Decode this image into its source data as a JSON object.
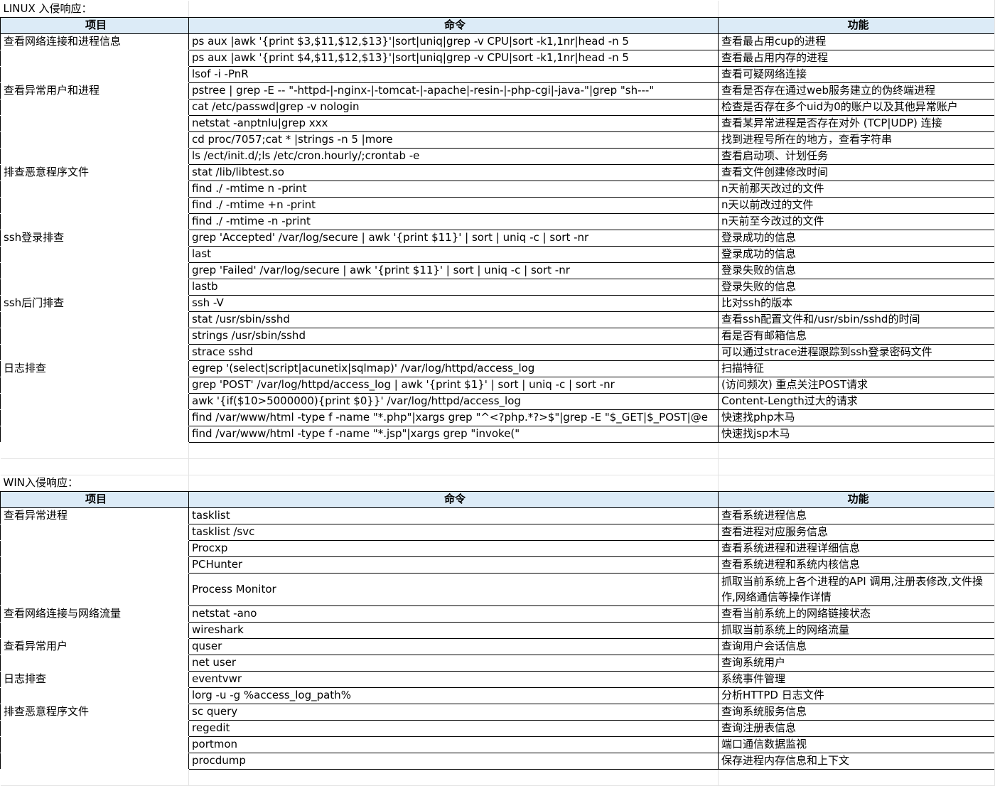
{
  "linux": {
    "title": "LINUX 入侵响应：",
    "headers": {
      "item": "项目",
      "cmd": "命令",
      "func": "功能"
    },
    "rows": [
      {
        "item": "查看网络连接和进程信息",
        "cmd": "ps aux |awk '{print $3,$11,$12,$13}'|sort|uniq|grep -v CPU|sort -k1,1nr|head -n 5",
        "func": "查看最占用cup的进程"
      },
      {
        "item": "",
        "cmd": "ps aux |awk '{print $4,$11,$12,$13}'|sort|uniq|grep -v CPU|sort -k1,1nr|head -n 5",
        "func": "查看最占用内存的进程"
      },
      {
        "item": "",
        "cmd": "lsof -i -PnR",
        "func": "查看可疑网络连接"
      },
      {
        "item": "查看异常用户和进程",
        "cmd": "pstree | grep -E -- \"-httpd-|-nginx-|-tomcat-|-apache|-resin-|-php-cgi|-java-\"|grep \"sh---\"",
        "func": "查看是否存在通过web服务建立的伪终端进程"
      },
      {
        "item": "",
        "cmd": "cat /etc/passwd|grep -v nologin",
        "func": "检查是否存在多个uid为0的账户以及其他异常账户"
      },
      {
        "item": "",
        "cmd": "netstat -anptnlu|grep xxx",
        "func": "查看某异常进程是否存在对外 (TCP|UDP) 连接"
      },
      {
        "item": "",
        "cmd": "cd proc/7057;cat * |strings -n 5 |more",
        "func": "找到进程号所在的地方，查看字符串"
      },
      {
        "item": "",
        "cmd": "ls /ect/init.d/;ls /etc/cron.hourly/;crontab -e",
        "func": "查看启动项、计划任务"
      },
      {
        "item": "排查恶意程序文件",
        "cmd": "stat /lib/libtest.so",
        "func": "查看文件创建修改时间"
      },
      {
        "item": "",
        "cmd": "find ./ -mtime n -print",
        "func": "n天前那天改过的文件"
      },
      {
        "item": "",
        "cmd": "find ./ -mtime +n -print",
        "func": "n天以前改过的文件"
      },
      {
        "item": "",
        "cmd": "find ./ -mtime -n -print",
        "func": "n天前至今改过的文件"
      },
      {
        "item": "ssh登录排查",
        "cmd": "grep 'Accepted' /var/log/secure | awk '{print $11}' | sort | uniq -c | sort -nr",
        "func": "登录成功的信息"
      },
      {
        "item": "",
        "cmd": "last",
        "func": "登录成功的信息"
      },
      {
        "item": "",
        "cmd": "grep 'Failed' /var/log/secure | awk '{print $11}' | sort | uniq -c | sort -nr",
        "func": "登录失败的信息"
      },
      {
        "item": "",
        "cmd": "lastb",
        "func": "登录失败的信息"
      },
      {
        "item": "ssh后门排查",
        "cmd": "ssh -V",
        "func": "比对ssh的版本"
      },
      {
        "item": "",
        "cmd": "stat /usr/sbin/sshd",
        "func": "查看ssh配置文件和/usr/sbin/sshd的时间"
      },
      {
        "item": "",
        "cmd": "strings /usr/sbin/sshd",
        "func": "看是否有邮箱信息"
      },
      {
        "item": "",
        "cmd": "strace sshd",
        "func": "可以通过strace进程跟踪到ssh登录密码文件"
      },
      {
        "item": "日志排查",
        "cmd": "egrep '(select|script|acunetix|sqlmap)' /var/log/httpd/access_log",
        "func": "扫描特征"
      },
      {
        "item": "",
        "cmd": "grep 'POST' /var/log/httpd/access_log | awk '{print $1}' | sort | uniq -c | sort -nr",
        "func": "(访问频次) 重点关注POST请求"
      },
      {
        "item": "",
        "cmd": "awk '{if($10>5000000){print $0}}' /var/log/httpd/access_log",
        "func": "Content-Length过大的请求"
      },
      {
        "item": "",
        "cmd": "find /var/www/html -type f -name \"*.php\"|xargs grep \"^<?php.*?>$\"|grep -E \"$_GET|$_POST|@e",
        "func": "快速找php木马"
      },
      {
        "item": "",
        "cmd": "find /var/www/html -type f -name \"*.jsp\"|xargs grep \"invoke(\"",
        "func": "快速找jsp木马"
      }
    ]
  },
  "win": {
    "title": "WIN入侵响应：",
    "headers": {
      "item": "项目",
      "cmd": "命令",
      "func": "功能"
    },
    "rows": [
      {
        "item": "查看异常进程",
        "cmd": "tasklist",
        "func": "查看系统进程信息"
      },
      {
        "item": "",
        "cmd": "tasklist /svc",
        "func": "查看进程对应服务信息"
      },
      {
        "item": "",
        "cmd": "Procxp",
        "func": "查看系统进程和进程详细信息"
      },
      {
        "item": "",
        "cmd": "PCHunter",
        "func": "查看系统进程和系统内核信息"
      },
      {
        "item": "",
        "cmd": "Process Monitor",
        "func": "抓取当前系统上各个进程的API 调用,注册表修改,文件操作,网络通信等操作详情",
        "tall": true
      },
      {
        "item": "查看网络连接与网络流量",
        "cmd": "netstat -ano",
        "func": "查看当前系统上的网络链接状态"
      },
      {
        "item": "",
        "cmd": "wireshark",
        "func": "抓取当前系统上的网络流量"
      },
      {
        "item": "查看异常用户",
        "cmd": "quser",
        "func": "查询用户会话信息"
      },
      {
        "item": "",
        "cmd": "net user",
        "func": "查询系统用户"
      },
      {
        "item": "日志排查",
        "cmd": "eventvwr",
        "func": "系统事件管理"
      },
      {
        "item": "",
        "cmd": "lorg -u -g %access_log_path%",
        "func": "分析HTTPD 日志文件"
      },
      {
        "item": "排查恶意程序文件",
        "cmd": "sc query",
        "func": "查询系统服务信息"
      },
      {
        "item": "",
        "cmd": "regedit",
        "func": "查询注册表信息"
      },
      {
        "item": "",
        "cmd": "portmon",
        "func": "端口通信数据监视"
      },
      {
        "item": "",
        "cmd": "procdump",
        "func": "保存进程内存信息和上下文"
      }
    ]
  }
}
